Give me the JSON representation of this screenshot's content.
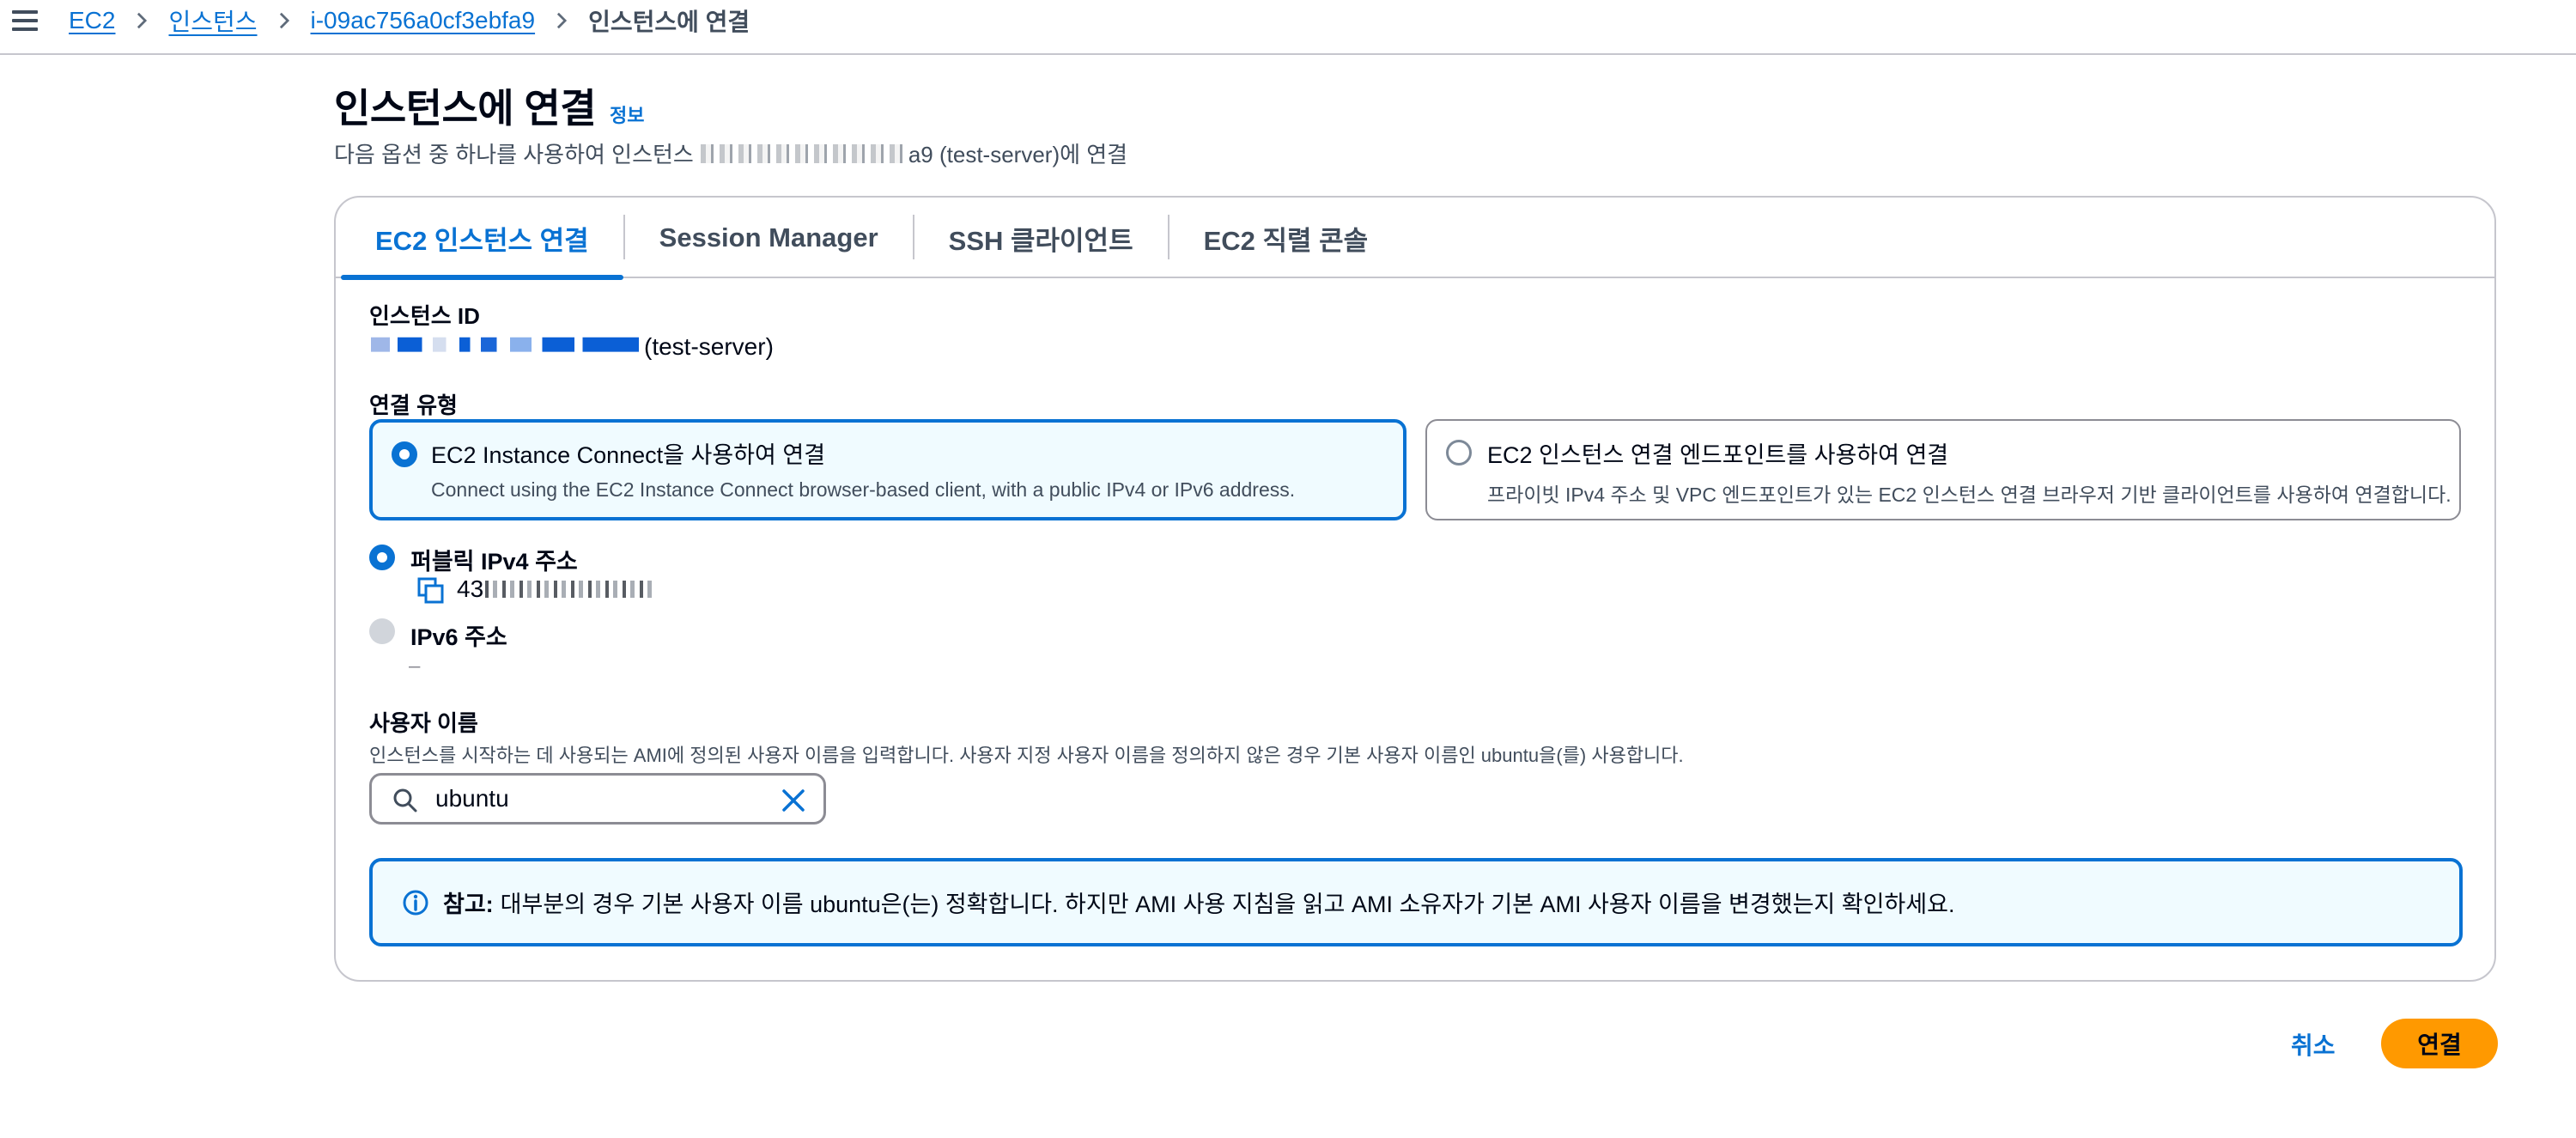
{
  "breadcrumb": {
    "items": [
      "EC2",
      "인스턴스",
      "i-09ac756a0cf3ebfa9"
    ],
    "current": "인스턴스에 연결"
  },
  "header": {
    "title": "인스턴스에 연결",
    "info": "정보",
    "description_prefix": "다음 옵션 중 하나를 사용하여 인스턴스",
    "description_suffix": "a9 (test-server)에 연결"
  },
  "tabs": [
    "EC2 인스턴스 연결",
    "Session Manager",
    "SSH 클라이언트",
    "EC2 직렬 콘솔"
  ],
  "instance": {
    "label": "인스턴스 ID",
    "name": "(test-server)"
  },
  "connection_type": {
    "label": "연결 유형",
    "options": [
      {
        "title": "EC2 Instance Connect을 사용하여 연결",
        "desc": "Connect using the EC2 Instance Connect browser-based client, with a public IPv4 or IPv6 address."
      },
      {
        "title": "EC2 인스턴스 연결 엔드포인트를 사용하여 연결",
        "desc": "프라이빗 IPv4 주소 및 VPC 엔드포인트가 있는 EC2 인스턴스 연결 브라우저 기반 클라이언트를 사용하여 연결합니다."
      }
    ]
  },
  "ip": {
    "public_label": "퍼블릭 IPv4 주소",
    "public_value_prefix": "43",
    "ipv6_label": "IPv6 주소",
    "ipv6_value": "–"
  },
  "username": {
    "label": "사용자 이름",
    "desc": "인스턴스를 시작하는 데 사용되는 AMI에 정의된 사용자 이름을 입력합니다. 사용자 지정 사용자 이름을 정의하지 않은 경우 기본 사용자 이름인 ubuntu을(를) 사용합니다.",
    "value": "ubuntu"
  },
  "alert": {
    "bold": "참고:",
    "text": "대부분의 경우 기본 사용자 이름 ubuntu은(는) 정확합니다. 하지만 AMI 사용 지침을 읽고 AMI 소유자가 기본 AMI 사용자 이름을 변경했는지 확인하세요."
  },
  "actions": {
    "cancel": "취소",
    "connect": "연결"
  },
  "colors": {
    "accent": "#0972d3",
    "primary_button": "#ff9900",
    "selected_bg": "#f0fbff"
  },
  "icons": [
    "menu-icon",
    "chevron-right-icon",
    "copy-icon",
    "search-icon",
    "close-icon",
    "info-icon"
  ]
}
